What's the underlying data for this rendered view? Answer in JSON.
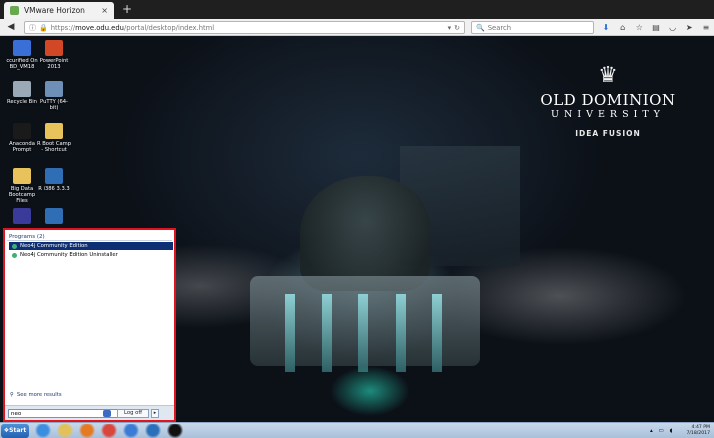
{
  "browser": {
    "tab_title": "VMware Horizon",
    "tab_close": "×",
    "new_tab": "+",
    "url_prefix": "https://",
    "url_host": "move.odu.edu",
    "url_path": "/portal/desktop/index.html",
    "search_placeholder": "Search",
    "back_icon": "back-arrow-icon",
    "toolbar_icons": [
      "download-icon",
      "home-icon",
      "bookmark-star-icon",
      "bookmarks-icon",
      "pocket-icon",
      "send-icon",
      "menu-icon"
    ]
  },
  "desktop": {
    "icons": [
      {
        "label": "ccurified On BD_VM18",
        "icon": "monitor-icon",
        "color": "#3a6fd8"
      },
      {
        "label": "PowerPoint 2013",
        "icon": "powerpoint-icon",
        "color": "#d24726"
      },
      {
        "label": "Recycle Bin",
        "icon": "recycle-bin-icon",
        "color": "#9aa9b5"
      },
      {
        "label": "PuTTY (64-bit)",
        "icon": "putty-icon",
        "color": "#6d8fb8"
      },
      {
        "label": "Anaconda Prompt",
        "icon": "terminal-icon",
        "color": "#1a1a1a"
      },
      {
        "label": "R Boot Camp - Shortcut",
        "icon": "folder-icon",
        "color": "#e8c25a"
      },
      {
        "label": "Big Data Bootcamp Files",
        "icon": "folder-icon",
        "color": "#e8c25a"
      },
      {
        "label": "R i386 3.3.3",
        "icon": "r-logo-icon",
        "color": "#2f6db5"
      },
      {
        "label": "",
        "icon": "app-icon",
        "color": "#3a3a9a"
      },
      {
        "label": "",
        "icon": "r-logo-icon",
        "color": "#2f6db5"
      }
    ],
    "logo": {
      "crown": "♛",
      "name": "OLD DOMINION",
      "university": "UNIVERSITY",
      "tagline": "IDEA FUSION"
    }
  },
  "start_menu": {
    "section_heading": "Programs (2)",
    "items": [
      {
        "label": "Neo4j Community Edition",
        "selected": true
      },
      {
        "label": "Neo4j Community Edition Uninstaller",
        "selected": false
      }
    ],
    "see_more": "See more results",
    "search_value": "neo",
    "logoff_label": "Log off",
    "arrow_label": "▸"
  },
  "taskbar": {
    "start_label": "Start",
    "apps": [
      {
        "icon": "internet-explorer-icon",
        "color": "#3e8ee0"
      },
      {
        "icon": "file-explorer-icon",
        "color": "#e3c15a"
      },
      {
        "icon": "media-player-icon",
        "color": "#e57a22"
      },
      {
        "icon": "chrome-icon",
        "color": "#d9463b"
      },
      {
        "icon": "network-icon",
        "color": "#3a7bd5"
      },
      {
        "icon": "neo4j-icon",
        "color": "#2a6fb9"
      },
      {
        "icon": "command-prompt-icon",
        "color": "#111111"
      }
    ],
    "tray_icons": "▴ ▭ ◖",
    "time": "4:47 PM",
    "date": "7/18/2017"
  }
}
